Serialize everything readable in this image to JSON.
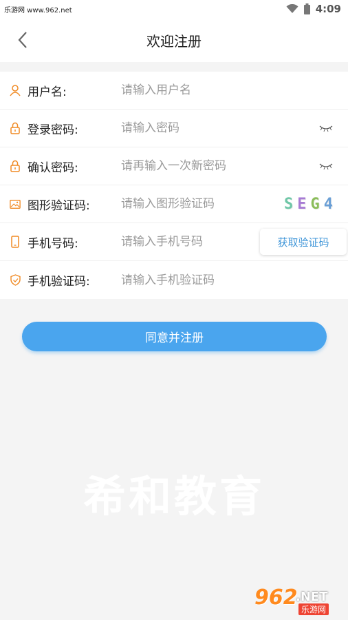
{
  "status_bar": {
    "site": "乐游网 www.962.net",
    "time": "4:09"
  },
  "header": {
    "title": "欢迎注册"
  },
  "form": {
    "username": {
      "label": "用户名:",
      "placeholder": "请输入用户名"
    },
    "password": {
      "label": "登录密码:",
      "placeholder": "请输入密码"
    },
    "confirm_password": {
      "label": "确认密码:",
      "placeholder": "请再输入一次新密码"
    },
    "captcha": {
      "label": "图形验证码:",
      "placeholder": "请输入图形验证码",
      "code": [
        "S",
        "E",
        "G",
        "4"
      ]
    },
    "phone": {
      "label": "手机号码:",
      "placeholder": "请输入手机号码",
      "sms_button": "获取验证码"
    },
    "sms_code": {
      "label": "手机验证码:",
      "placeholder": "请输入手机验证码"
    }
  },
  "submit_label": "同意并注册",
  "watermark": "希和教育",
  "site_logo": {
    "number": "962",
    "domain": ".NET",
    "name": "乐游网"
  },
  "colors": {
    "accent": "#4aa5ee",
    "icon": "#f08a24",
    "link": "#3e95d8"
  },
  "icons": {
    "back": "chevron-left-icon",
    "wifi": "wifi-icon",
    "battery": "battery-icon",
    "user": "user-icon",
    "lock": "lock-icon",
    "image": "image-icon",
    "phone": "phone-icon",
    "shield": "shield-icon",
    "eye": "eye-closed-icon"
  }
}
